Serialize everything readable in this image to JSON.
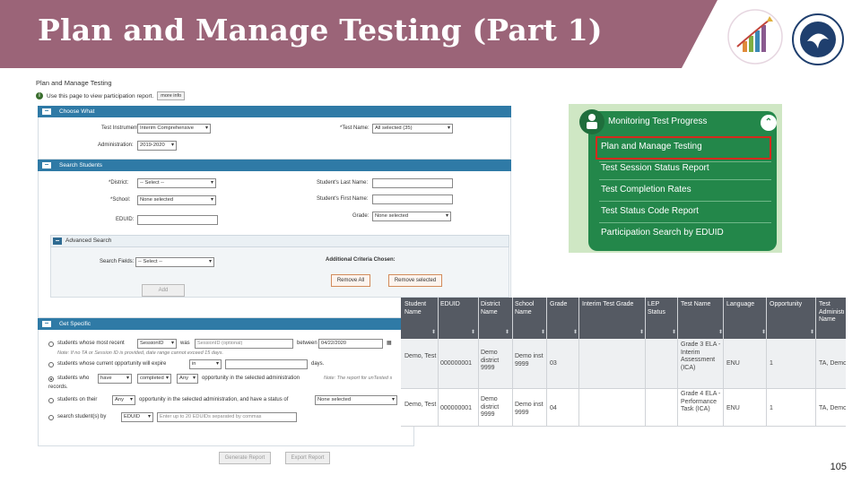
{
  "slide": {
    "title": "Plan and Manage Testing (Part 1)",
    "page_number": "105",
    "accent": "#9b6478"
  },
  "form": {
    "page_title": "Plan and Manage Testing",
    "info_text": "Use this page to view participation report.",
    "more_info": "more info",
    "sections": {
      "choose_what": "Choose What",
      "search_students": "Search Students",
      "advanced_search": "Advanced Search",
      "get_specific": "Get Specific"
    },
    "fields": {
      "test_instrument_label": "Test Instrument:",
      "test_instrument_value": "Interim Comprehensive",
      "test_name_label": "*Test Name:",
      "test_name_value": "All selected (35)",
      "administration_label": "Administration:",
      "administration_value": "2019-2020",
      "district_label": "*District:",
      "district_value": "-- Select --",
      "last_name_label": "Student's Last Name:",
      "school_label": "*School:",
      "school_value": "None selected",
      "first_name_label": "Student's First Name:",
      "grade_label": "Grade:",
      "grade_value": "None selected",
      "eduid_label": "EDUID:",
      "search_fields_label": "Search Fields:",
      "search_fields_value": "-- Select --",
      "additional_criteria": "Additional Criteria Chosen:",
      "remove_all": "Remove All",
      "remove_selected": "Remove selected",
      "add": "Add"
    },
    "specific": {
      "opt1_text": "students whose most recent",
      "opt1_select": "SessionID",
      "opt1_was": "was",
      "opt1_input": "SessionID (optional)",
      "opt1_between": "between",
      "opt1_date": "04/22/2020",
      "opt1_note": "Note: If no TA or Session ID is provided, date range cannot exceed 15 days.",
      "opt2_text": "students whose current opportunity will expire",
      "opt2_select": "in",
      "opt2_days": "days.",
      "opt3_text": "students who",
      "opt3_select1": "have",
      "opt3_select2": "completed",
      "opt3_select3": "Any",
      "opt3_rest": "opportunity in the selected administration",
      "opt3_note": "Note: The report for unTested s",
      "opt3_records": "records.",
      "opt4_text": "students on their",
      "opt4_select": "Any",
      "opt4_rest": "opportunity in the selected administration, and have a status of",
      "opt4_status": "None selected",
      "opt5_text": "search student(s) by",
      "opt5_select": "EDUID",
      "opt5_placeholder": "Enter up to 20 EDUIDs separated by commas",
      "generate": "Generate Report",
      "export": "Export Report"
    }
  },
  "menu": {
    "header": "Monitoring Test Progress",
    "items": [
      "Plan and Manage Testing",
      "Test Session Status Report",
      "Test Completion Rates",
      "Test Status Code Report",
      "Participation Search by EDUID"
    ],
    "highlight_color": "#d42a1d"
  },
  "table": {
    "headers": [
      "Student Name",
      "EDUID",
      "District Name",
      "School Name",
      "Grade",
      "Interim Test Grade",
      "LEP Status",
      "Test Name",
      "Language",
      "Opportunity",
      "Test Administrator Name"
    ],
    "rows": [
      [
        "Demo, Test",
        "000000001",
        "Demo district 9999",
        "Demo inst 9999",
        "03",
        "",
        "",
        "Grade 3 ELA - Interim Assessment (ICA)",
        "ENU",
        "1",
        "TA, Demo"
      ],
      [
        "Demo, Test",
        "000000001",
        "Demo district 9999",
        "Demo inst 9999",
        "04",
        "",
        "",
        "Grade 4 ELA - Performance Task (ICA)",
        "ENU",
        "1",
        "TA, Demo"
      ]
    ]
  }
}
